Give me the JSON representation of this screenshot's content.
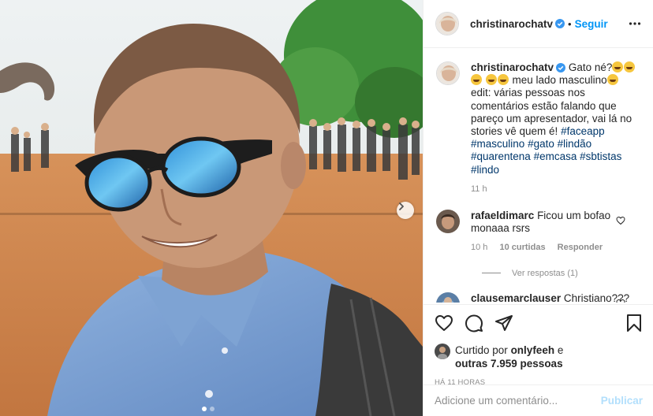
{
  "post": {
    "author": "christinarochatv",
    "follow_label": "Seguir",
    "separator": "•",
    "caption": {
      "prefix": "Gato né?",
      "middle": "meu lado masculino",
      "body": "edit: várias pessoas nos comentários estão falando que pareço um apresentador, vai lá no stories vê quem é!",
      "hashtags": [
        "#faceapp",
        "#masculino",
        "#gato",
        "#lindão",
        "#quarentena",
        "#emcasa",
        "#sbtistas",
        "#lindo"
      ],
      "time": "11 h"
    },
    "photo_alt": "Selfie com óculos escuros espelhados azuis e camisa azul",
    "carousel": {
      "slides": 2,
      "active": 0
    }
  },
  "comments": [
    {
      "username": "rafaeldimarc",
      "text": "Ficou um bofao monaaa rsrs",
      "time": "10 h",
      "likes": "10 curtidas",
      "reply_label": "Responder",
      "view_replies": "Ver respostas (1)"
    },
    {
      "username": "clausemarclauser",
      "text": "Christiano???"
    }
  ],
  "likes": {
    "prefix": "Curtido por",
    "by": "onlyfeeh",
    "joiner": "e",
    "others": "outras 7.959 pessoas"
  },
  "time_ago": "HÁ 11 HORAS",
  "composer": {
    "placeholder": "Adicione um comentário...",
    "publish_label": "Publicar"
  },
  "colors": {
    "accent": "#0095f6",
    "verified": "#3897f0",
    "hashtag": "#00376b",
    "muted": "#8e8e8e",
    "publish_disabled": "#b2dffc"
  },
  "icons": {
    "header_more": "more-horizontal-icon",
    "verified": "verified-badge-icon",
    "next": "chevron-right-icon",
    "like": "heart-icon",
    "comment": "comment-bubble-icon",
    "share": "paper-plane-icon",
    "save": "bookmark-icon"
  }
}
